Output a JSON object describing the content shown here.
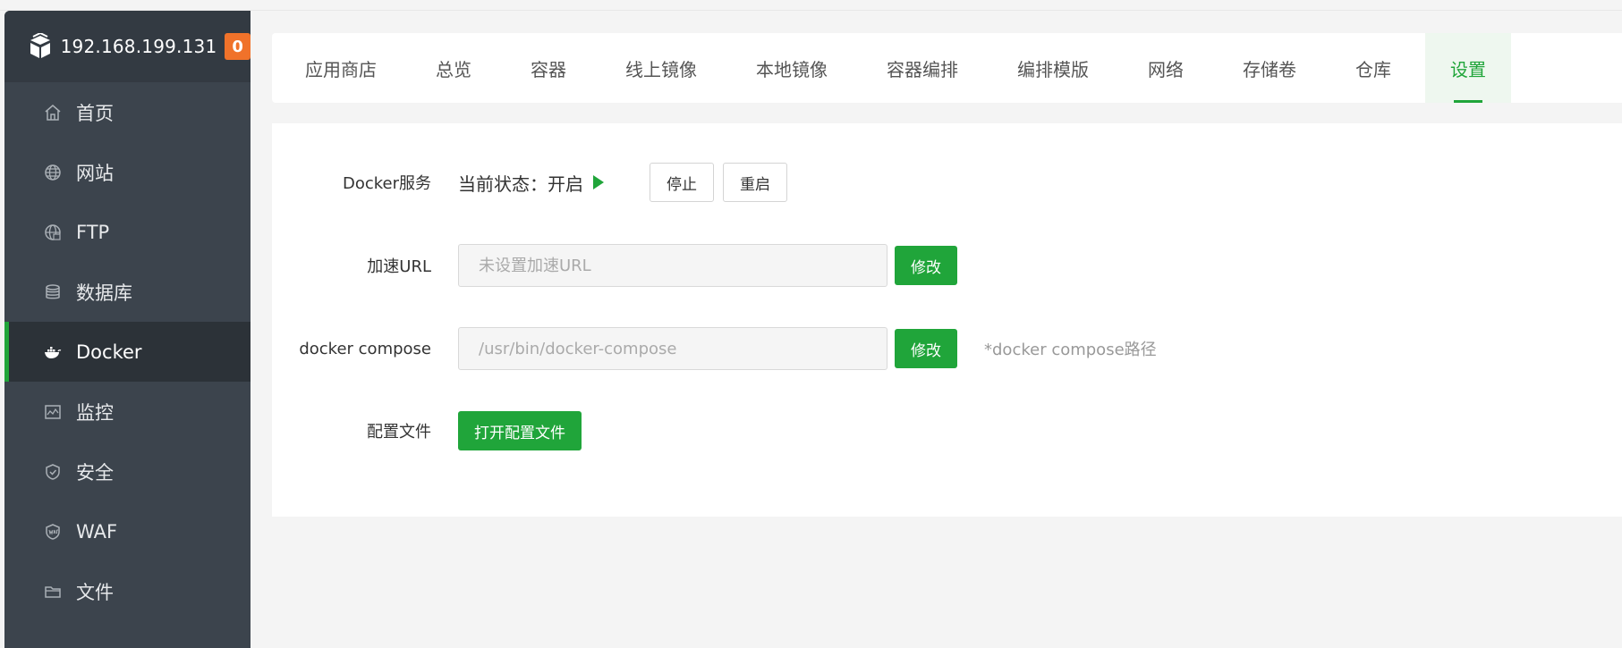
{
  "server": {
    "ip": "192.168.199.131",
    "badge": "0"
  },
  "sidebar": {
    "items": [
      {
        "label": "首页",
        "icon": "home-icon"
      },
      {
        "label": "网站",
        "icon": "globe-icon"
      },
      {
        "label": "FTP",
        "icon": "ftp-icon"
      },
      {
        "label": "数据库",
        "icon": "database-icon"
      },
      {
        "label": "Docker",
        "icon": "docker-icon",
        "active": true
      },
      {
        "label": "监控",
        "icon": "monitor-icon"
      },
      {
        "label": "安全",
        "icon": "shield-icon"
      },
      {
        "label": "WAF",
        "icon": "waf-icon"
      },
      {
        "label": "文件",
        "icon": "folder-icon"
      }
    ]
  },
  "tabs": [
    {
      "label": "应用商店"
    },
    {
      "label": "总览"
    },
    {
      "label": "容器"
    },
    {
      "label": "线上镜像"
    },
    {
      "label": "本地镜像"
    },
    {
      "label": "容器编排"
    },
    {
      "label": "编排模版"
    },
    {
      "label": "网络"
    },
    {
      "label": "存储卷"
    },
    {
      "label": "仓库"
    },
    {
      "label": "设置",
      "active": true
    }
  ],
  "settings": {
    "docker_service": {
      "label": "Docker服务",
      "status": "当前状态：开启",
      "stop_label": "停止",
      "restart_label": "重启"
    },
    "accel_url": {
      "label": "加速URL",
      "value": "",
      "placeholder": "未设置加速URL",
      "button_label": "修改"
    },
    "compose": {
      "label": "docker compose",
      "value": "",
      "placeholder": "/usr/bin/docker-compose",
      "button_label": "修改",
      "hint": "*docker compose路径"
    },
    "config_file": {
      "label": "配置文件",
      "button_label": "打开配置文件"
    }
  },
  "colors": {
    "accent": "#20a53a",
    "sidebar_bg": "#3c444d",
    "badge": "#f0722a"
  }
}
